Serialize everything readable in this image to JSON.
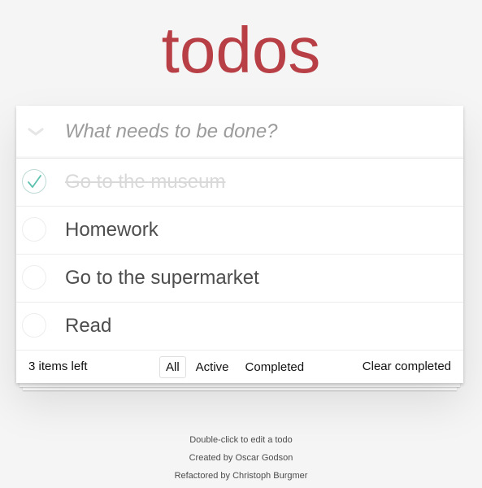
{
  "app": {
    "title": "todos"
  },
  "header": {
    "new_todo_placeholder": "What needs to be done?",
    "toggle_all_icon": "chevron-down-icon"
  },
  "todos": [
    {
      "label": "Go to the museum",
      "completed": true
    },
    {
      "label": "Homework",
      "completed": false
    },
    {
      "label": "Go to the supermarket",
      "completed": false
    },
    {
      "label": "Read",
      "completed": false
    }
  ],
  "footer": {
    "items_left": "3 items left",
    "filters": [
      {
        "label": "All",
        "selected": true
      },
      {
        "label": "Active",
        "selected": false
      },
      {
        "label": "Completed",
        "selected": false
      }
    ],
    "clear_completed": "Clear completed"
  },
  "info": {
    "line1": "Double-click to edit a todo",
    "line2": "Created by Oscar Godson",
    "line3": "Refactored by Christoph Burgmer"
  },
  "colors": {
    "title": "#b83f45",
    "checkmark": "#5dc2af",
    "background": "#f5f5f5"
  }
}
